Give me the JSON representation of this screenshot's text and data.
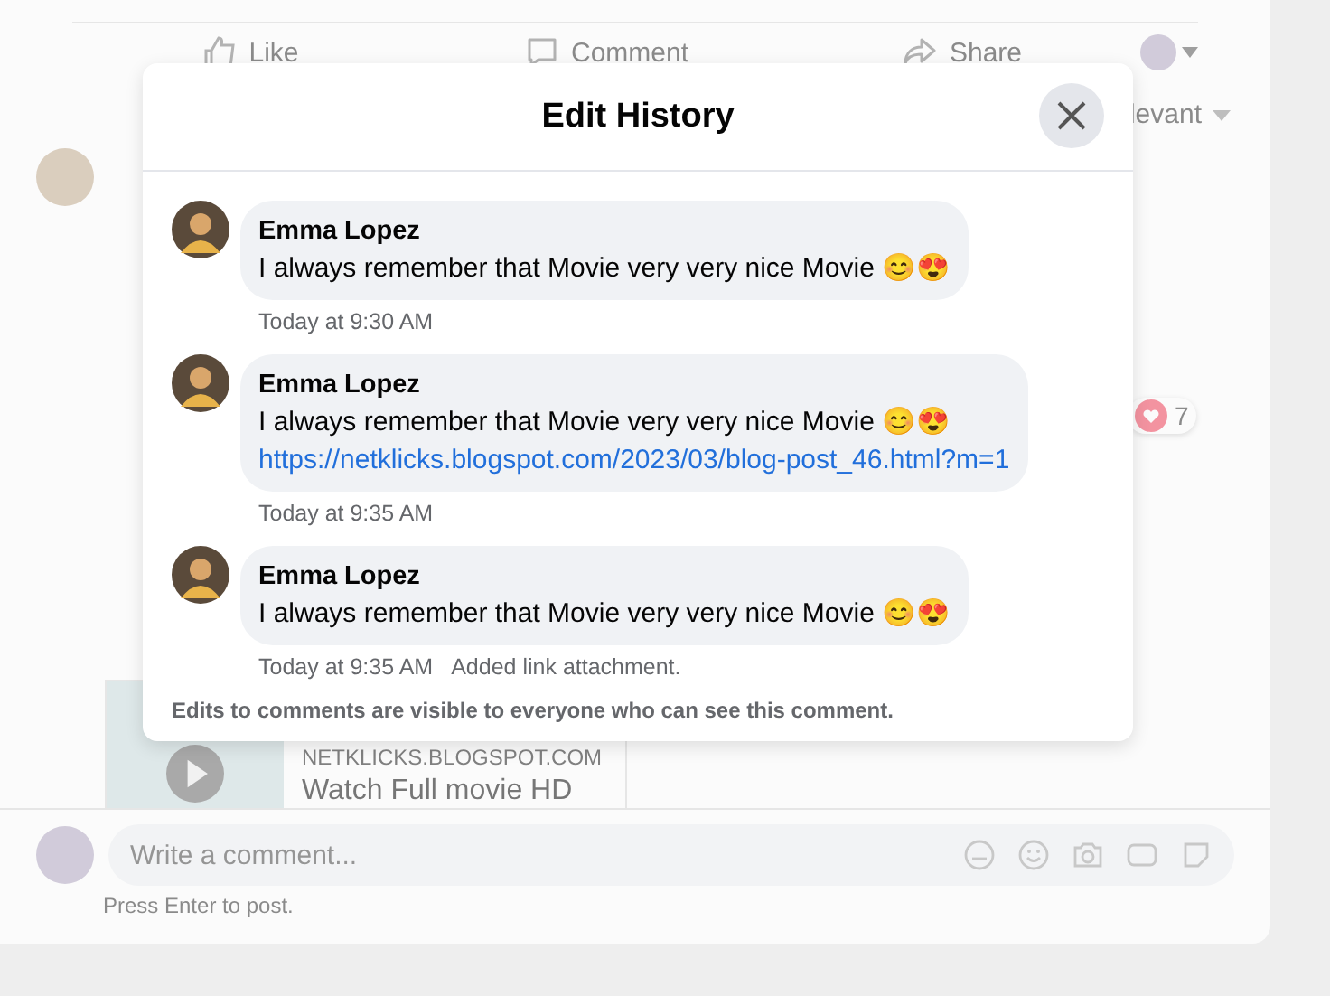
{
  "background": {
    "actions": [
      {
        "kind": "like",
        "label": "Like"
      },
      {
        "kind": "comment",
        "label": "Comment"
      },
      {
        "kind": "share",
        "label": "Share"
      }
    ],
    "sort_label": "levant",
    "reaction_count": "7",
    "link_preview": {
      "domain": "NETKLICKS.BLOGSPOT.COM",
      "title": "Watch Full movie HD"
    },
    "comment_box": {
      "placeholder": "Write a comment...",
      "hint": "Press Enter to post."
    }
  },
  "dialog": {
    "title": "Edit History",
    "entries": [
      {
        "name": "Emma Lopez",
        "text": "I always remember that Movie very very nice Movie 😊😍",
        "time": "Today at 9:30 AM"
      },
      {
        "name": "Emma Lopez",
        "text": "I always remember that Movie very very nice Movie 😊😍",
        "link": "https://netklicks.blogspot.com/2023/03/blog-post_46.html?m=1",
        "time": "Today at 9:35 AM"
      },
      {
        "name": "Emma Lopez",
        "text": "I always remember that Movie very very nice Movie 😊😍",
        "time": "Today at 9:35 AM",
        "change": "Added link attachment."
      }
    ],
    "note": "Edits to comments are visible to everyone who can see this comment."
  }
}
